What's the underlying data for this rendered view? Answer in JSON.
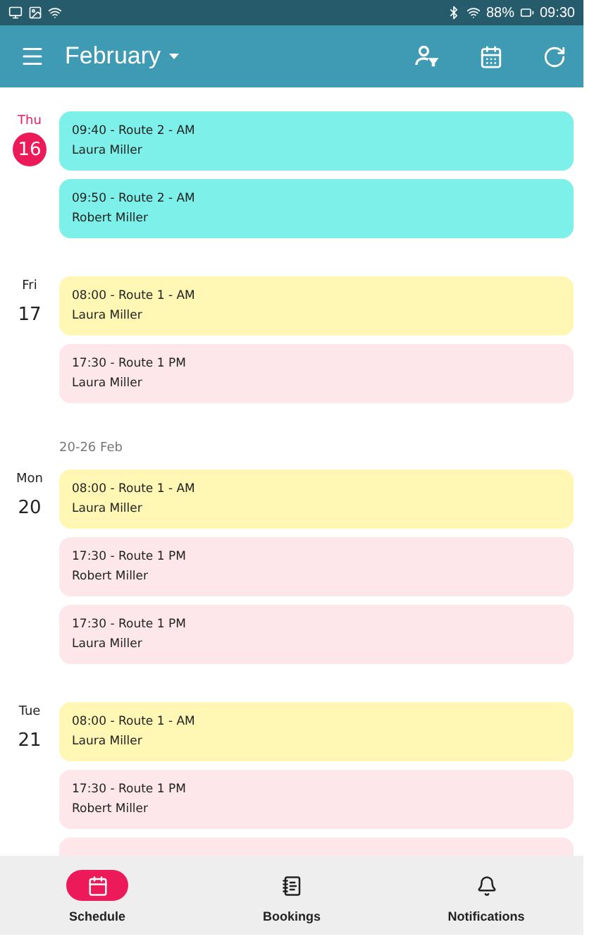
{
  "status_bar": {
    "battery": "88%",
    "time": "09:30"
  },
  "app_bar": {
    "title": "February"
  },
  "sections": [
    {
      "days": [
        {
          "weekday": "Thu",
          "day": "16",
          "today": true,
          "events": [
            {
              "title": "09:40 - Route 2 - AM",
              "person": "Laura Miller",
              "color": "#7ef0ea"
            },
            {
              "title": "09:50 - Route 2 - AM",
              "person": "Robert Miller",
              "color": "#7ef0ea"
            }
          ]
        },
        {
          "weekday": "Fri",
          "day": "17",
          "today": false,
          "events": [
            {
              "title": "08:00 - Route 1 - AM",
              "person": "Laura Miller",
              "color": "#fff7b3"
            },
            {
              "title": "17:30 - Route 1 PM",
              "person": "Laura Miller",
              "color": "#fde7ea"
            }
          ]
        }
      ]
    },
    {
      "week_label": "20-26 Feb",
      "days": [
        {
          "weekday": "Mon",
          "day": "20",
          "today": false,
          "events": [
            {
              "title": "08:00 - Route 1 - AM",
              "person": "Laura Miller",
              "color": "#fff7b3"
            },
            {
              "title": "17:30 - Route 1 PM",
              "person": "Robert Miller",
              "color": "#fde7ea"
            },
            {
              "title": "17:30 - Route 1 PM",
              "person": "Laura Miller",
              "color": "#fde7ea"
            }
          ]
        },
        {
          "weekday": "Tue",
          "day": "21",
          "today": false,
          "events": [
            {
              "title": "08:00 - Route 1 - AM",
              "person": "Laura Miller",
              "color": "#fff7b3"
            },
            {
              "title": "17:30 - Route 1 PM",
              "person": "Robert Miller",
              "color": "#fde7ea"
            },
            {
              "color": "#fde7ea"
            }
          ]
        }
      ]
    }
  ],
  "nav": [
    {
      "label": "Schedule",
      "selected": true
    },
    {
      "label": "Bookings",
      "selected": false
    },
    {
      "label": "Notifications",
      "selected": false
    }
  ]
}
